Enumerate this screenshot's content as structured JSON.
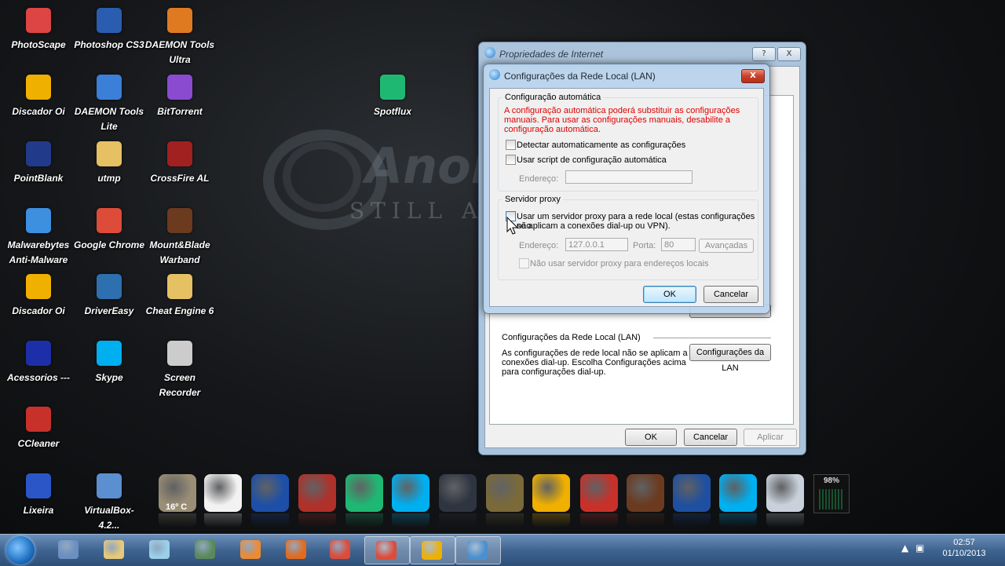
{
  "desktop": {
    "background_text": "STILL ALIV",
    "background_logo_text": "Anon",
    "icons": [
      {
        "label": "PhotoScape",
        "color": "#d44"
      },
      {
        "label": "Photoshop CS3",
        "color": "#2a5db0"
      },
      {
        "label": "DAEMON Tools Ultra",
        "color": "#e07a20"
      },
      {
        "label": "Discador Oi",
        "color": "#f0b000"
      },
      {
        "label": "DAEMON Tools Lite",
        "color": "#3b7fd8"
      },
      {
        "label": "BitTorrent",
        "color": "#8a4bd0"
      },
      {
        "label": "Spotflux",
        "color": "#1fb873"
      },
      {
        "label": "PointBlank",
        "color": "#223a8a"
      },
      {
        "label": "utmp",
        "color": "#e6c163"
      },
      {
        "label": "CrossFire AL",
        "color": "#a12020"
      },
      {
        "label": "Malwarebytes Anti-Malware",
        "color": "#3d8fe0"
      },
      {
        "label": "Google Chrome",
        "color": "#dd4b39"
      },
      {
        "label": "Mount&Blade Warband",
        "color": "#6b3a1f"
      },
      {
        "label": "Discador Oi",
        "color": "#f0b000"
      },
      {
        "label": "DriverEasy",
        "color": "#2e6fb0"
      },
      {
        "label": "Cheat Engine 6",
        "color": "#e6c163"
      },
      {
        "label": "Acessorios ---",
        "color": "#1d2fa8"
      },
      {
        "label": "Skype",
        "color": "#00aff0"
      },
      {
        "label": "Screen Recorder",
        "color": "#cccccc"
      },
      {
        "label": "CCleaner",
        "color": "#c8302a"
      },
      {
        "label": "Lixeira",
        "color": "#2a56c8"
      },
      {
        "label": "VirtualBox-4.2...",
        "color": "#5b8fd0"
      }
    ]
  },
  "dock": {
    "weather_temp": "16º C",
    "meter_value": "98%",
    "items": [
      {
        "name": "weather",
        "color": "#9a8e76"
      },
      {
        "name": "daemon-tools",
        "color": "#f2f2f2"
      },
      {
        "name": "pointblank",
        "color": "#1d4fa8"
      },
      {
        "name": "crossfire",
        "color": "#b0302a"
      },
      {
        "name": "spotflux",
        "color": "#1fb873"
      },
      {
        "name": "skype",
        "color": "#00aff0"
      },
      {
        "name": "alienware",
        "color": "#2e3540"
      },
      {
        "name": "atom",
        "color": "#7a6a3a"
      },
      {
        "name": "oi",
        "color": "#f0b000"
      },
      {
        "name": "ccleaner",
        "color": "#c8302a"
      },
      {
        "name": "warband",
        "color": "#6b3a1f"
      },
      {
        "name": "photoshop",
        "color": "#1f4fa0"
      },
      {
        "name": "skype-2",
        "color": "#00aff0"
      },
      {
        "name": "recycle-bin",
        "color": "#c9d2dc"
      }
    ]
  },
  "taskbar": {
    "time": "02:57",
    "date": "01/10/2013",
    "items": [
      {
        "name": "control-panel",
        "color": "#6a8fc0",
        "active": false
      },
      {
        "name": "windows-explorer",
        "color": "#e8c978",
        "active": false
      },
      {
        "name": "notepad",
        "color": "#9ad0e8",
        "active": false
      },
      {
        "name": "task-manager",
        "color": "#5a8a5a",
        "active": false
      },
      {
        "name": "media-player",
        "color": "#f08a30",
        "active": false
      },
      {
        "name": "firefox",
        "color": "#e66a1a",
        "active": false
      },
      {
        "name": "chrome",
        "color": "#dd4b39",
        "active": false
      },
      {
        "name": "chrome-2",
        "color": "#dd4b39",
        "active": true
      },
      {
        "name": "oi",
        "color": "#f0b000",
        "active": true
      },
      {
        "name": "internet-options",
        "color": "#4a90d0",
        "active": true
      }
    ]
  },
  "internet_properties": {
    "title": "Propriedades de Internet",
    "help_btn": "?",
    "close_btn": "X",
    "lan_section_title": "Configurações da Rede Local (LAN)",
    "lan_description_1": "As configurações de rede local não se aplicam a",
    "lan_description_2": "conexões dial-up. Escolha Configurações acima",
    "lan_description_3": "para configurações dial-up.",
    "lan_button": "Configurações da LAN",
    "ok": "OK",
    "cancel": "Cancelar",
    "apply": "Aplicar"
  },
  "lan_dialog": {
    "title": "Configurações da Rede Local (LAN)",
    "close_btn": "X",
    "auto_group": "Configuração automática",
    "auto_warning_1": "A configuração automática poderá substituir as configurações",
    "auto_warning_2": "manuais. Para usar as configurações manuais, desabilite a",
    "auto_warning_3": "configuração automática.",
    "auto_detect": "Detectar automaticamente as configurações",
    "use_script": "Usar script de configuração automática",
    "address_label": "Endereço:",
    "proxy_group": "Servidor proxy",
    "use_proxy_1": "Usar um servidor proxy para a rede local (estas configurações não",
    "use_proxy_2": "se aplicam a conexões dial-up ou VPN).",
    "proxy_address_label": "Endereço:",
    "proxy_address_value": "127.0.0.1",
    "port_label": "Porta:",
    "port_value": "80",
    "advanced": "Avançadas",
    "bypass_local": "Não usar servidor proxy para endereços locais",
    "ok": "OK",
    "cancel": "Cancelar"
  }
}
